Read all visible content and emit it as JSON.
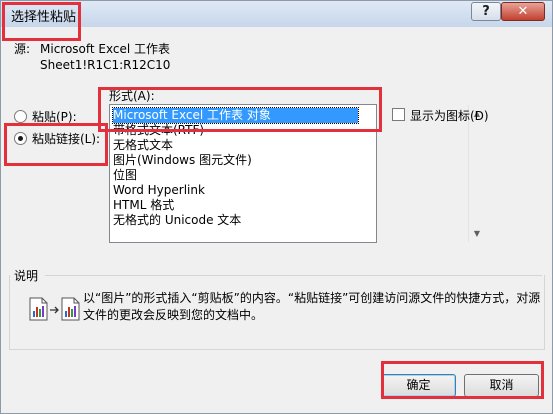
{
  "dialog": {
    "title": "选择性粘贴",
    "help_button": "?",
    "close_button": "✕"
  },
  "source": {
    "label": "源:",
    "name": "Microsoft Excel 工作表",
    "range": "Sheet1!R1C1:R12C10"
  },
  "format_label": "形式(A):",
  "options": {
    "paste": "粘贴(P):",
    "paste_link": "粘贴链接(L):",
    "selected": "paste_link"
  },
  "formats": [
    "Microsoft Excel 工作表 对象",
    "带格式文本(RTF)",
    "无格式文本",
    "图片(Windows 图元文件)",
    "位图",
    "Word Hyperlink",
    "HTML 格式",
    "无格式的 Unicode 文本"
  ],
  "selected_format_index": 0,
  "display_as_icon": "显示为图标(D)",
  "result": {
    "label": "说明",
    "line1": "以“图片”的形式插入“剪贴板”的内容。“粘贴链接”可创建访问源文件的快捷方式，对源",
    "line2": "文件的更改会反映到您的文档中。"
  },
  "buttons": {
    "ok": "确定",
    "cancel": "取消"
  },
  "colors": {
    "annotation": "#e2313c",
    "selection": "#3399ff"
  }
}
